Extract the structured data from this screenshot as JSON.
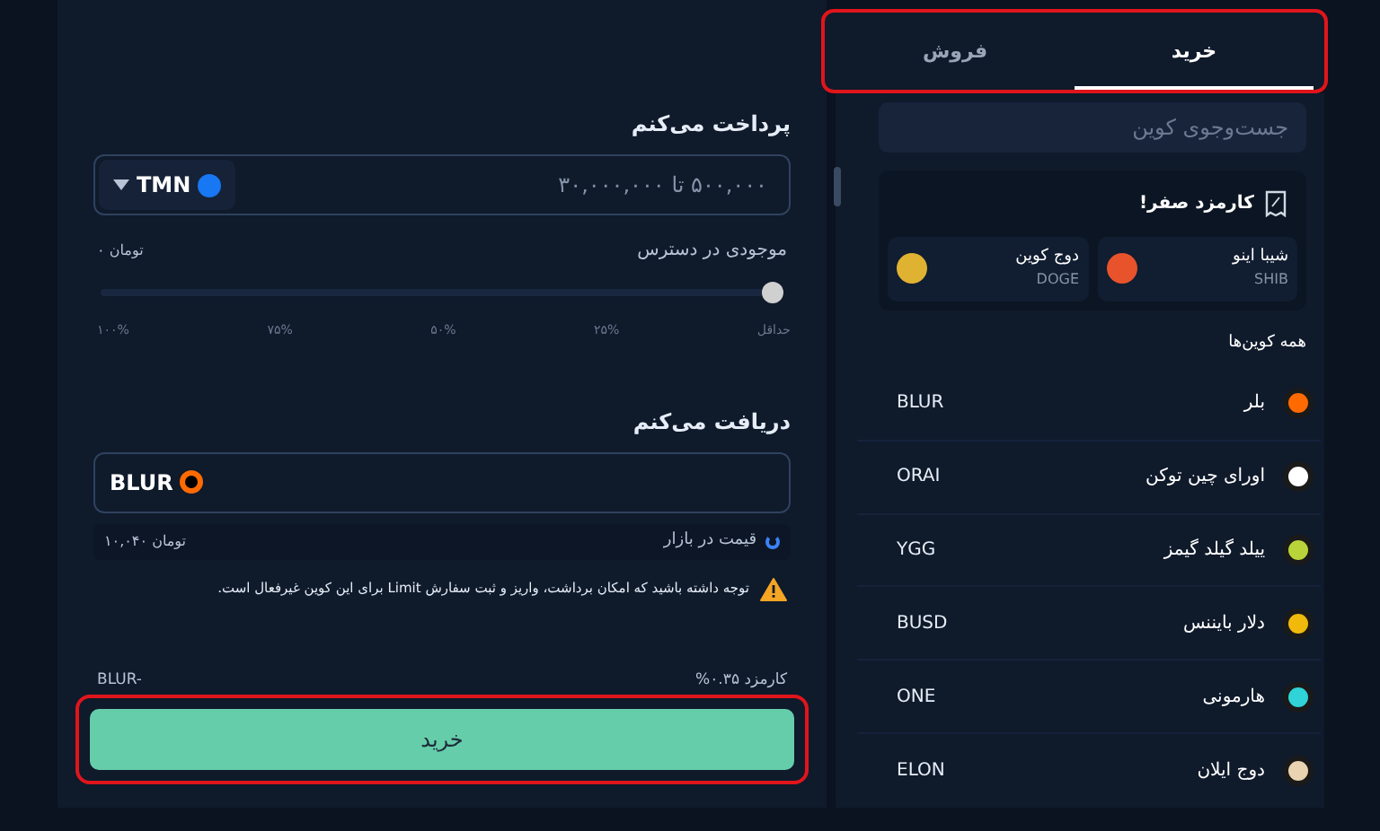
{
  "pay": {
    "title": "پرداخت می‌کنم",
    "placeholder": "۵۰۰,۰۰۰ تا ۳۰,۰۰۰,۰۰۰",
    "currency": "TMN",
    "balance_label": "موجودی در دسترس",
    "balance": "۰ تومان",
    "slider": {
      "level": 0,
      "ticks": [
        "حداقل",
        "۲۵%",
        "۵۰%",
        "۷۵%",
        "۱۰۰%"
      ]
    }
  },
  "receive": {
    "title": "دریافت می‌کنم",
    "coin": "BLUR",
    "price_label": "قیمت در بازار",
    "price": "۱۰,۰۴۰ تومان",
    "warning": "توجه داشته باشید که امکان برداشت، واریز و ثبت سفارش Limit برای این کوین غیرفعال است."
  },
  "fee": "کارمزد ۰.۳۵%",
  "fee_amount": "BLUR-",
  "submit": "خرید",
  "tabs": [
    {
      "label": "خرید",
      "selected": true
    },
    {
      "label": "فروش",
      "selected": false
    }
  ],
  "search": {
    "placeholder": "جست‌وجوی کوین"
  },
  "zero_fee": {
    "title": "کارمزد صفر!",
    "coins": [
      {
        "name": "شیبا اینو",
        "symbol": "SHIB",
        "color": "#e8532b"
      },
      {
        "name": "دوج کوین",
        "symbol": "DOGE",
        "color": "#e0b232"
      }
    ]
  },
  "all_title": "همه کوین‌ها",
  "coins": [
    {
      "name": "بلر",
      "symbol": "BLUR",
      "color": "#ff6a00"
    },
    {
      "name": "اورای چین توکن",
      "symbol": "ORAI",
      "color": "#ffffff"
    },
    {
      "name": "ییلد گیلد گیمز",
      "symbol": "YGG",
      "color": "#b8d43a"
    },
    {
      "name": "دلار بایننس",
      "symbol": "BUSD",
      "color": "#f0b90b"
    },
    {
      "name": "هارمونی",
      "symbol": "ONE",
      "color": "#2fd3d8"
    },
    {
      "name": "دوج ایلان",
      "symbol": "ELON",
      "color": "#e9d3b0"
    }
  ]
}
